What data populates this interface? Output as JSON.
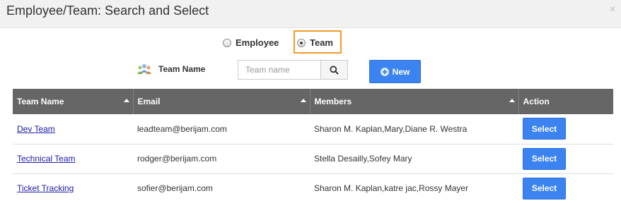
{
  "dialog": {
    "title": "Employee/Team: Search and Select",
    "close_label": "×"
  },
  "mode": {
    "options": [
      "Employee",
      "Team"
    ],
    "selected": "Team"
  },
  "search": {
    "label": "Team Name",
    "placeholder": "Team name",
    "value": "",
    "new_button_label": "New"
  },
  "table": {
    "columns": [
      "Team Name",
      "Email",
      "Members",
      "Action"
    ],
    "rows": [
      {
        "team_name": "Dev Team",
        "email": "leadteam@berijam.com",
        "members": "Sharon M. Kaplan,Mary,Diane R. Westra",
        "action": "Select"
      },
      {
        "team_name": "Technical Team",
        "email": "rodger@berijam.com",
        "members": "Stella Desailly,Sofey Mary",
        "action": "Select"
      },
      {
        "team_name": "Ticket Tracking",
        "email": "sofier@berijam.com",
        "members": "Sharon M. Kaplan,katre jac,Rossy Mayer",
        "action": "Select"
      }
    ]
  },
  "colors": {
    "header_bg": "#666666",
    "button_blue": "#3b83f0",
    "highlight_orange": "#f39a28",
    "link_blue": "#1a1aa6"
  },
  "icons": [
    "close-icon",
    "team-icon",
    "search-icon",
    "plus-icon",
    "sort-asc-icon"
  ]
}
